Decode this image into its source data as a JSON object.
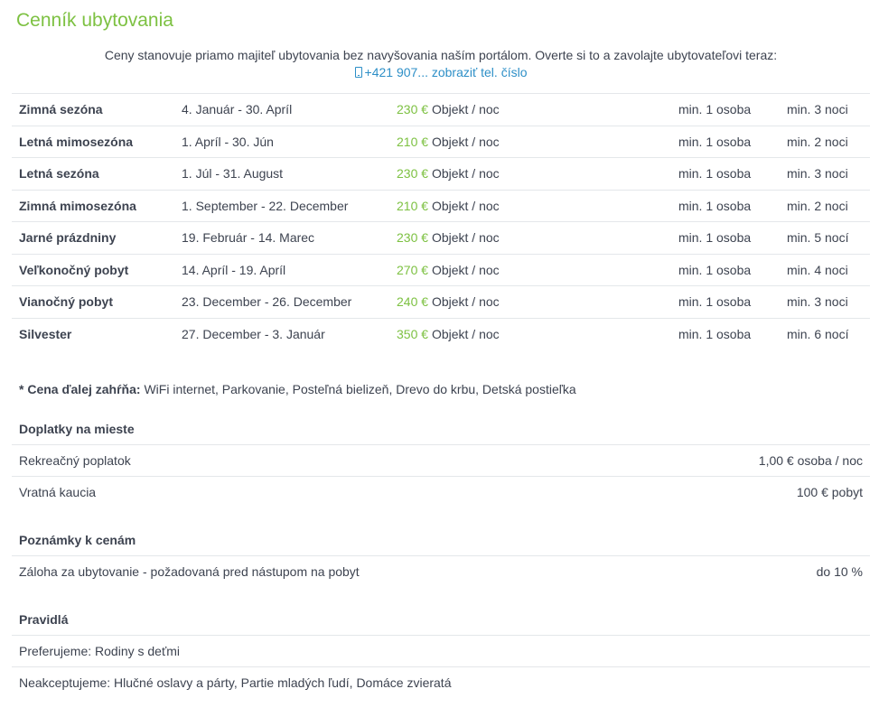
{
  "title": "Cenník ubytovania",
  "intro": {
    "text": "Ceny stanovuje priamo majiteľ ubytovania bez navyšovania naším portálom. Overte si to a zavolajte ubytovateľovi teraz:",
    "phone_icon": "mobile-phone-icon",
    "phone_link": "+421 907... zobraziť tel. číslo"
  },
  "colors": {
    "accent": "#7dc142",
    "link": "#2d8fc7",
    "text": "#3d4350",
    "divider": "#e4e7ea"
  },
  "prices": [
    {
      "season": "Zimná sezóna",
      "dates": "4. Január - 30. Apríl",
      "price": "230 €",
      "unit": "Objekt / noc",
      "persons": "min. 1 osoba",
      "nights": "min. 3 noci"
    },
    {
      "season": "Letná mimosezóna",
      "dates": "1. Apríl - 30. Jún",
      "price": "210 €",
      "unit": "Objekt / noc",
      "persons": "min. 1 osoba",
      "nights": "min. 2 noci"
    },
    {
      "season": "Letná sezóna",
      "dates": "1. Júl - 31. August",
      "price": "230 €",
      "unit": "Objekt / noc",
      "persons": "min. 1 osoba",
      "nights": "min. 3 noci"
    },
    {
      "season": "Zimná mimosezóna",
      "dates": "1. September - 22. December",
      "price": "210 €",
      "unit": "Objekt / noc",
      "persons": "min. 1 osoba",
      "nights": "min. 2 noci"
    },
    {
      "season": "Jarné prázdniny",
      "dates": "19. Február - 14. Marec",
      "price": "230 €",
      "unit": "Objekt / noc",
      "persons": "min. 1 osoba",
      "nights": "min. 5 nocí"
    },
    {
      "season": "Veľkonočný pobyt",
      "dates": "14. Apríl - 19. Apríl",
      "price": "270 €",
      "unit": "Objekt / noc",
      "persons": "min. 1 osoba",
      "nights": "min. 4 noci"
    },
    {
      "season": "Vianočný pobyt",
      "dates": "23. December - 26. December",
      "price": "240 €",
      "unit": "Objekt / noc",
      "persons": "min. 1 osoba",
      "nights": "min. 3 noci"
    },
    {
      "season": "Silvester",
      "dates": "27. December - 3. Január",
      "price": "350 €",
      "unit": "Objekt / noc",
      "persons": "min. 1 osoba",
      "nights": "min. 6 nocí"
    }
  ],
  "includes": {
    "label": "* Cena ďalej zahŕňa:",
    "value": "WiFi internet, Parkovanie, Posteľná bielizeň, Drevo do krbu, Detská postieľka"
  },
  "surcharges": {
    "title": "Doplatky na mieste",
    "rows": [
      {
        "label": "Rekreačný poplatok",
        "value": "1,00 € osoba / noc"
      },
      {
        "label": "Vratná kaucia",
        "value": "100 € pobyt"
      }
    ]
  },
  "notes": {
    "title": "Poznámky k cenám",
    "rows": [
      {
        "label": "Záloha za ubytovanie - požadovaná pred nástupom na pobyt",
        "value": "do 10 %"
      }
    ]
  },
  "rules": {
    "title": "Pravidlá",
    "rows": [
      {
        "label": "Preferujeme: Rodiny s deťmi"
      },
      {
        "label": "Neakceptujeme: Hlučné oslavy a párty, Partie mladých ľudí, Domáce zvieratá"
      }
    ]
  }
}
